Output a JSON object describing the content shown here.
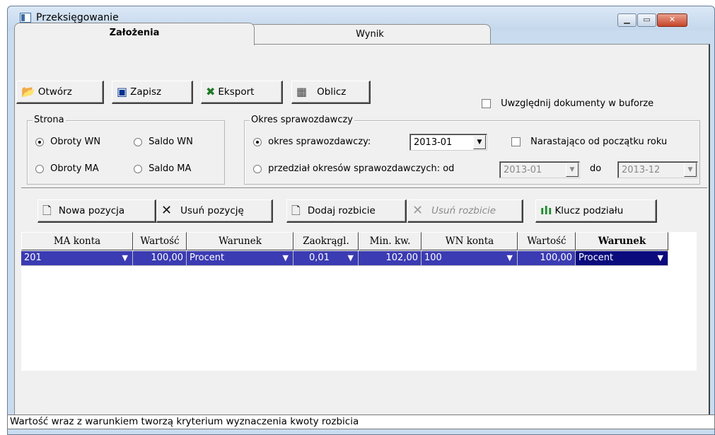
{
  "window": {
    "title": "Przeksięgowanie"
  },
  "tabs": [
    {
      "label": "Założenia",
      "active": true
    },
    {
      "label": "Wynik",
      "active": false
    }
  ],
  "toolbar": {
    "open_label": "Otwórz",
    "save_label": "Zapisz",
    "export_label": "Eksport",
    "calc_label": "Oblicz"
  },
  "options": {
    "include_buffer_label": "Uwzględnij dokumenty w buforze",
    "include_buffer_checked": false
  },
  "strona": {
    "legend": "Strona",
    "radios": [
      {
        "label": "Obroty WN",
        "selected": true
      },
      {
        "label": "Saldo WN",
        "selected": false
      },
      {
        "label": "Obroty MA",
        "selected": false
      },
      {
        "label": "Saldo MA",
        "selected": false
      }
    ]
  },
  "okres": {
    "legend": "Okres sprawozdawczy",
    "radio_period_label": "okres sprawozdawczy:",
    "period_value": "2013-01",
    "cumulative_label": "Narastająco od początku roku",
    "cumulative_checked": false,
    "radio_range_label": "przedział okresów sprawozdawczych: od",
    "range_from": "2013-01",
    "range_to_label": "do",
    "range_to": "2013-12"
  },
  "actions": {
    "new_position": "Nowa pozycja",
    "delete_position": "Usuń pozycję",
    "add_split": "Dodaj rozbicie",
    "delete_split": "Usuń rozbicie",
    "split_key": "Klucz podziału"
  },
  "grid": {
    "headers": [
      "MA konta",
      "Wartość",
      "Warunek",
      "Zaokrągl.",
      "Min. kw.",
      "WN konta",
      "Wartość",
      "Warunek"
    ],
    "rows": [
      {
        "ma_konta": "201",
        "wartosc1": "100,00",
        "warunek1": "Procent",
        "zaokragl": "0,01",
        "min_kw": "102,00",
        "wn_konta": "100",
        "wartosc2": "100,00",
        "warunek2": "Procent"
      }
    ]
  },
  "status": {
    "text": "Wartość wraz z warunkiem tworzą kryterium wyznaczenia kwoty rozbicia"
  },
  "colors": {
    "selection": "#3b3bb3",
    "selection_focus": "#0b0b7e",
    "window_frame": "#c9dcef"
  }
}
